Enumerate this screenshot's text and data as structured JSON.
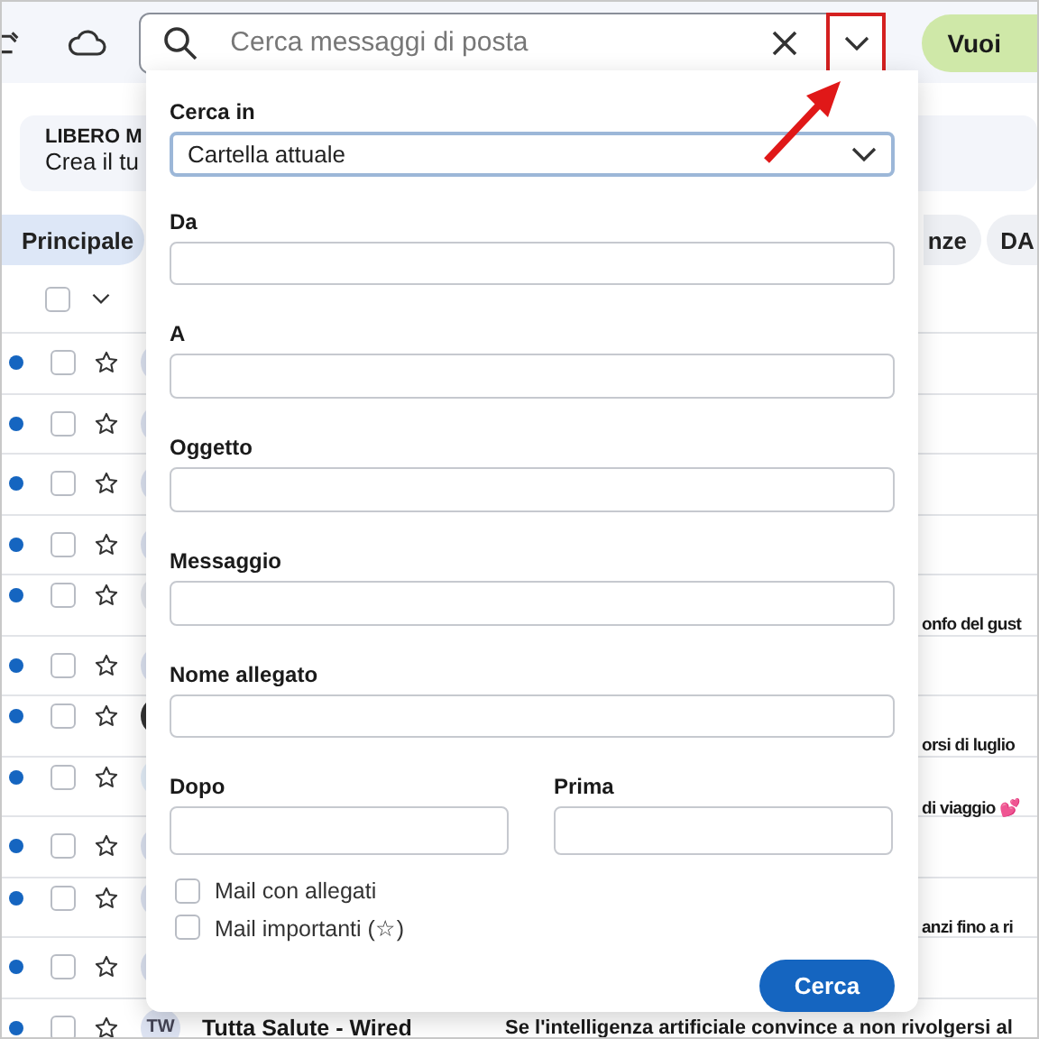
{
  "top_bar": {
    "search": {
      "placeholder": "Cerca messaggi di posta"
    },
    "action_button": "Vuoi"
  },
  "banner": {
    "title": "LIBERO M",
    "text": "Crea il tu"
  },
  "tabs": [
    {
      "label": "Principale",
      "selected": true
    },
    {
      "label": "nze",
      "selected": false
    },
    {
      "label": "DA",
      "selected": false
    }
  ],
  "list_header": {
    "checked": false
  },
  "messages": [
    {
      "color": "#dde3f2",
      "unread": true,
      "checked": false,
      "starred": false
    },
    {
      "color": "#dde3f2",
      "unread": true,
      "checked": false,
      "starred": false
    },
    {
      "color": "#dde3f2",
      "unread": true,
      "checked": false,
      "starred": false
    },
    {
      "color": "#dde3f2",
      "unread": true,
      "checked": false,
      "starred": false
    },
    {
      "color": "#e4e7ee",
      "unread": true,
      "checked": false,
      "starred": false,
      "subject": "onfo del gust"
    },
    {
      "color": "#dde3f2",
      "unread": true,
      "checked": false,
      "starred": false
    },
    {
      "color": "#333333",
      "unread": true,
      "checked": false,
      "starred": false,
      "subject": "orsi di luglio"
    },
    {
      "color": "#e6f0fb",
      "unread": true,
      "checked": false,
      "starred": false,
      "subject": "di viaggio 💕"
    },
    {
      "color": "#dde3f2",
      "unread": true,
      "checked": false,
      "starred": false
    },
    {
      "color": "#dde3f2",
      "unread": true,
      "checked": false,
      "starred": false,
      "subject": "anzi fino a ri"
    },
    {
      "color": "#dde3f2",
      "unread": true,
      "checked": false,
      "starred": false
    },
    {
      "avatar": "TW",
      "color": "#dde3f2",
      "unread": true,
      "checked": false,
      "starred": false,
      "sender": "Tutta Salute - Wired",
      "subject": "Se l'intelligenza artificiale convince a non rivolgersi al"
    }
  ],
  "search_panel": {
    "scope": {
      "label": "Cerca in",
      "value": "Cartella attuale"
    },
    "fields": [
      {
        "label": "Da"
      },
      {
        "label": "A"
      },
      {
        "label": "Oggetto"
      },
      {
        "label": "Messaggio"
      },
      {
        "label": "Nome allegato"
      }
    ],
    "date_fields": [
      {
        "label": "Dopo"
      },
      {
        "label": "Prima"
      }
    ],
    "options": [
      {
        "label": "Mail con allegati",
        "checked": false
      },
      {
        "label": "Mail importanti (☆)",
        "checked": false
      }
    ],
    "submit": "Cerca"
  }
}
